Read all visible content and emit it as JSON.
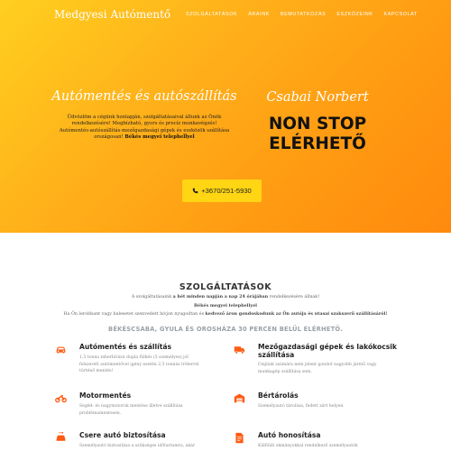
{
  "nav": {
    "brand": "Medgyesi Autómentő",
    "items": [
      "SZOLGÁLTATÁSOK",
      "ÁRAINK",
      "BEMUTATKOZÁS",
      "ESZKÖZEINK",
      "KAPCSOLAT"
    ]
  },
  "hero": {
    "left_title": "Autómentés és autószállítás",
    "left_text_1": "Üdvözlöm a cégünk honlapján, szolgáltatásaival állunk az Önök rendelkezésére! Megbízható, gyors és precíz munkavégzés! Autómentés-autószállítás-mezőgazdasági gépek és eszközök szállítása országosan!",
    "left_text_bold": "Békés megyei telephellyel",
    "right_title": "Csabai Norbert",
    "nonstop_1": "NON STOP",
    "nonstop_2": "ELÉRHETŐ",
    "phone": "+3670/251-5930"
  },
  "services_section": {
    "title": "SZOLGÁLTATÁSOK",
    "intro_1a": "A szolgáltatásaink ",
    "intro_1b": "a hét minden napján a nap 24 órájában",
    "intro_1c": " rendelkezésére állnak!",
    "intro_2": "Békés megyei telephellyel",
    "intro_3a": "Ha Ön lerobbant vagy balesetet szenvedett hívjon nyugodtan és ",
    "intro_3b": "kedvező áron gondoskodunk az Ön autója és utasai szakszerű szállításáról!",
    "region": "BÉKÉSCSABA, GYULA ÉS OROSHÁZA 30 PERCEN BELÜL ELÉRHETŐ."
  },
  "services": [
    {
      "title": "Autómentés és szállítás",
      "desc": "1,5 tonna teherbírású dupla fülkés (5 személyes) jól felszerelt autómentővel igény esetén 2,5 tonnás trélerrel történő mentés!",
      "icon": "car-icon"
    },
    {
      "title": "Mezőgazdasági gépek és lakókocsik szállítása",
      "desc": "Cégünk számára nem jelent gondot nagyobb jármű vagy munkagép szállítása sem.",
      "icon": "truck-icon"
    },
    {
      "title": "Motormentés",
      "desc": "Segéd- és nagymotorok mentése illetve szállítása problémamentesen.",
      "icon": "motorcycle-icon"
    },
    {
      "title": "Bértárolás",
      "desc": "Személyautó tárolása, fedett zárt helyen.",
      "icon": "warehouse-icon"
    },
    {
      "title": "Csere autó biztosítása",
      "desc": "Személyautó biztosítása a szükséges időtartamra, akár",
      "icon": "car-exchange-icon"
    },
    {
      "title": "Autó honosítása",
      "desc": "Külföldi okmányokkal rendelkező személyautók",
      "icon": "document-icon"
    }
  ],
  "colors": {
    "accent": "#ff5a12",
    "button": "#ffd514",
    "hero_from": "#ffcf1f",
    "hero_to": "#ff8a0d"
  }
}
